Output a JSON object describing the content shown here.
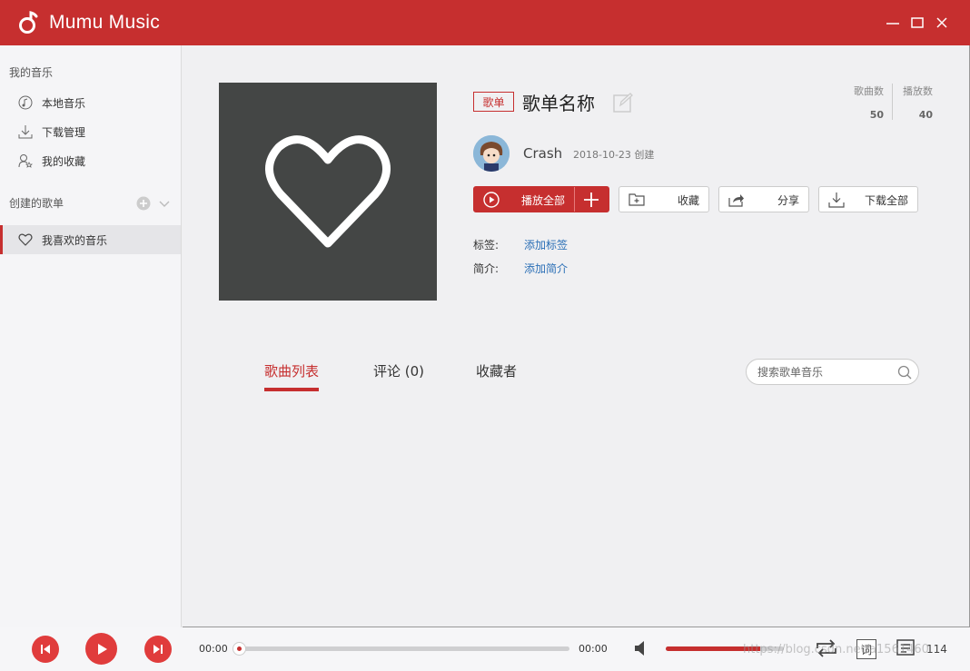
{
  "app": {
    "title": "Mumu Music"
  },
  "sidebar": {
    "my_music_label": "我的音乐",
    "items": [
      {
        "label": "本地音乐",
        "icon": "music-note-icon"
      },
      {
        "label": "下载管理",
        "icon": "download-icon"
      },
      {
        "label": "我的收藏",
        "icon": "user-star-icon"
      }
    ],
    "created_label": "创建的歌单",
    "playlists": [
      {
        "label": "我喜欢的音乐",
        "icon": "heart-icon",
        "active": true
      }
    ]
  },
  "playlist": {
    "tag": "歌单",
    "name": "歌单名称",
    "stats": {
      "songs_label": "歌曲数",
      "songs": "50",
      "plays_label": "播放数",
      "plays": "40"
    },
    "creator": "Crash",
    "created": "2018-10-23 创建",
    "buttons": {
      "play_all": "播放全部",
      "collect": "收藏",
      "share": "分享",
      "download_all": "下载全部"
    },
    "tags_label": "标签:",
    "tags_add": "添加标签",
    "intro_label": "简介:",
    "intro_add": "添加简介"
  },
  "tabs": {
    "songs": "歌曲列表",
    "comments": "评论 (0)",
    "subscribers": "收藏者"
  },
  "search": {
    "placeholder": "搜索歌单音乐"
  },
  "player": {
    "current_time": "00:00",
    "total_time": "00:00",
    "progress": 0,
    "volume": 0.8,
    "lyric_label": "词",
    "playlist_count": "114",
    "watermark": "https://blog.csdn.net/a1561460"
  },
  "colors": {
    "accent": "#c62f2f",
    "link": "#2b6fb6",
    "cover_bg": "#444645"
  }
}
